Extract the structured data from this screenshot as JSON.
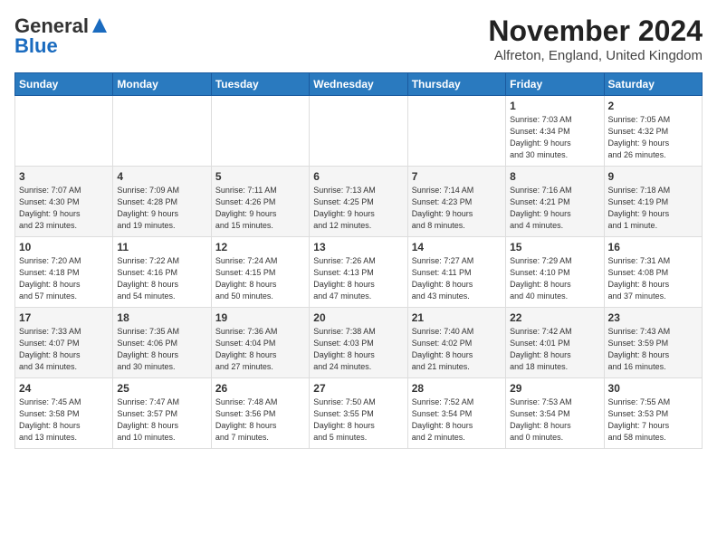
{
  "header": {
    "logo_line1": "General",
    "logo_line2": "Blue",
    "title": "November 2024",
    "location": "Alfreton, England, United Kingdom"
  },
  "days_of_week": [
    "Sunday",
    "Monday",
    "Tuesday",
    "Wednesday",
    "Thursday",
    "Friday",
    "Saturday"
  ],
  "weeks": [
    [
      {
        "day": "",
        "info": ""
      },
      {
        "day": "",
        "info": ""
      },
      {
        "day": "",
        "info": ""
      },
      {
        "day": "",
        "info": ""
      },
      {
        "day": "",
        "info": ""
      },
      {
        "day": "1",
        "info": "Sunrise: 7:03 AM\nSunset: 4:34 PM\nDaylight: 9 hours\nand 30 minutes."
      },
      {
        "day": "2",
        "info": "Sunrise: 7:05 AM\nSunset: 4:32 PM\nDaylight: 9 hours\nand 26 minutes."
      }
    ],
    [
      {
        "day": "3",
        "info": "Sunrise: 7:07 AM\nSunset: 4:30 PM\nDaylight: 9 hours\nand 23 minutes."
      },
      {
        "day": "4",
        "info": "Sunrise: 7:09 AM\nSunset: 4:28 PM\nDaylight: 9 hours\nand 19 minutes."
      },
      {
        "day": "5",
        "info": "Sunrise: 7:11 AM\nSunset: 4:26 PM\nDaylight: 9 hours\nand 15 minutes."
      },
      {
        "day": "6",
        "info": "Sunrise: 7:13 AM\nSunset: 4:25 PM\nDaylight: 9 hours\nand 12 minutes."
      },
      {
        "day": "7",
        "info": "Sunrise: 7:14 AM\nSunset: 4:23 PM\nDaylight: 9 hours\nand 8 minutes."
      },
      {
        "day": "8",
        "info": "Sunrise: 7:16 AM\nSunset: 4:21 PM\nDaylight: 9 hours\nand 4 minutes."
      },
      {
        "day": "9",
        "info": "Sunrise: 7:18 AM\nSunset: 4:19 PM\nDaylight: 9 hours\nand 1 minute."
      }
    ],
    [
      {
        "day": "10",
        "info": "Sunrise: 7:20 AM\nSunset: 4:18 PM\nDaylight: 8 hours\nand 57 minutes."
      },
      {
        "day": "11",
        "info": "Sunrise: 7:22 AM\nSunset: 4:16 PM\nDaylight: 8 hours\nand 54 minutes."
      },
      {
        "day": "12",
        "info": "Sunrise: 7:24 AM\nSunset: 4:15 PM\nDaylight: 8 hours\nand 50 minutes."
      },
      {
        "day": "13",
        "info": "Sunrise: 7:26 AM\nSunset: 4:13 PM\nDaylight: 8 hours\nand 47 minutes."
      },
      {
        "day": "14",
        "info": "Sunrise: 7:27 AM\nSunset: 4:11 PM\nDaylight: 8 hours\nand 43 minutes."
      },
      {
        "day": "15",
        "info": "Sunrise: 7:29 AM\nSunset: 4:10 PM\nDaylight: 8 hours\nand 40 minutes."
      },
      {
        "day": "16",
        "info": "Sunrise: 7:31 AM\nSunset: 4:08 PM\nDaylight: 8 hours\nand 37 minutes."
      }
    ],
    [
      {
        "day": "17",
        "info": "Sunrise: 7:33 AM\nSunset: 4:07 PM\nDaylight: 8 hours\nand 34 minutes."
      },
      {
        "day": "18",
        "info": "Sunrise: 7:35 AM\nSunset: 4:06 PM\nDaylight: 8 hours\nand 30 minutes."
      },
      {
        "day": "19",
        "info": "Sunrise: 7:36 AM\nSunset: 4:04 PM\nDaylight: 8 hours\nand 27 minutes."
      },
      {
        "day": "20",
        "info": "Sunrise: 7:38 AM\nSunset: 4:03 PM\nDaylight: 8 hours\nand 24 minutes."
      },
      {
        "day": "21",
        "info": "Sunrise: 7:40 AM\nSunset: 4:02 PM\nDaylight: 8 hours\nand 21 minutes."
      },
      {
        "day": "22",
        "info": "Sunrise: 7:42 AM\nSunset: 4:01 PM\nDaylight: 8 hours\nand 18 minutes."
      },
      {
        "day": "23",
        "info": "Sunrise: 7:43 AM\nSunset: 3:59 PM\nDaylight: 8 hours\nand 16 minutes."
      }
    ],
    [
      {
        "day": "24",
        "info": "Sunrise: 7:45 AM\nSunset: 3:58 PM\nDaylight: 8 hours\nand 13 minutes."
      },
      {
        "day": "25",
        "info": "Sunrise: 7:47 AM\nSunset: 3:57 PM\nDaylight: 8 hours\nand 10 minutes."
      },
      {
        "day": "26",
        "info": "Sunrise: 7:48 AM\nSunset: 3:56 PM\nDaylight: 8 hours\nand 7 minutes."
      },
      {
        "day": "27",
        "info": "Sunrise: 7:50 AM\nSunset: 3:55 PM\nDaylight: 8 hours\nand 5 minutes."
      },
      {
        "day": "28",
        "info": "Sunrise: 7:52 AM\nSunset: 3:54 PM\nDaylight: 8 hours\nand 2 minutes."
      },
      {
        "day": "29",
        "info": "Sunrise: 7:53 AM\nSunset: 3:54 PM\nDaylight: 8 hours\nand 0 minutes."
      },
      {
        "day": "30",
        "info": "Sunrise: 7:55 AM\nSunset: 3:53 PM\nDaylight: 7 hours\nand 58 minutes."
      }
    ]
  ]
}
